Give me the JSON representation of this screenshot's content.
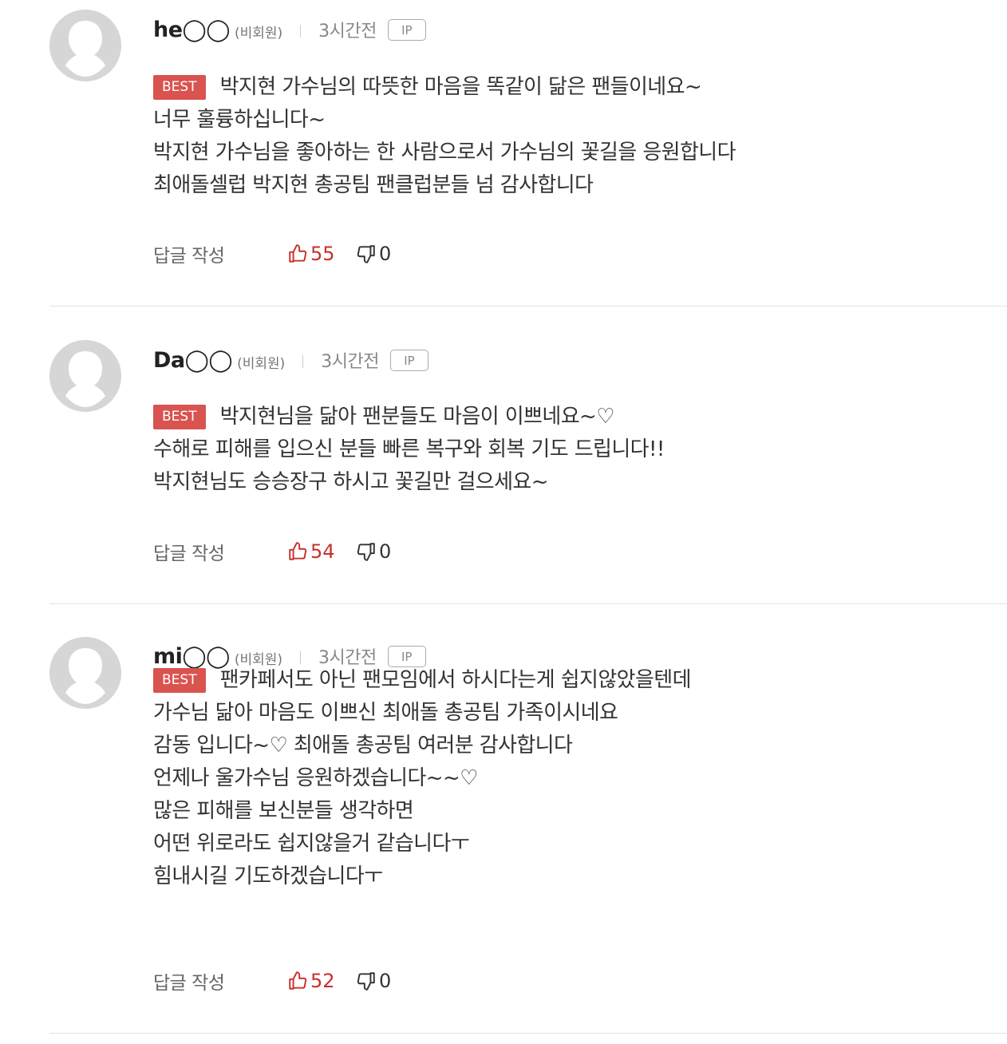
{
  "ui": {
    "member_label": "(비회원)",
    "ip_label": "IP",
    "best_label": "BEST",
    "reply_label": "답글 작성",
    "colors": {
      "best_badge": "#d9534f",
      "like": "#c9302c",
      "avatar": "#d6d6d6"
    },
    "icons": [
      "user-avatar-icon",
      "thumbs-up-icon",
      "thumbs-down-icon"
    ]
  },
  "comments": [
    {
      "nickname": "he◯◯",
      "time": "3시간전",
      "lines": [
        "박지현 가수님의 따뜻한 마음을 똑같이 닮은 팬들이네요~",
        "너무 훌륭하십니다~",
        "박지현 가수님을 좋아하는 한 사람으로서 가수님의 꽃길을 응원합니다",
        "최애돌셀럽 박지현 총공팀 팬클럽분들 넘 감사합니다"
      ],
      "likes": "55",
      "dislikes": "0"
    },
    {
      "nickname": "Da◯◯",
      "time": "3시간전",
      "lines": [
        "박지현님을 닮아 팬분들도 마음이 이쁘네요~♡",
        "수해로 피해를 입으신 분들 빠른 복구와 회복 기도 드립니다!!",
        "박지현님도 승승장구 하시고 꽃길만 걸으세요~"
      ],
      "likes": "54",
      "dislikes": "0"
    },
    {
      "nickname": "mi◯◯",
      "time": "3시간전",
      "lines": [
        "팬카페서도 아닌 팬모임에서 하시다는게 쉽지않았을텐데",
        "가수님 닮아 마음도 이쁘신 최애돌 총공팀 가족이시네요",
        "감동 입니다~♡ 최애돌 총공팀 여러분 감사합니다",
        "언제나 울가수님 응원하겠습니다~~♡",
        "많은 피해를 보신분들 생각하면",
        "어떤 위로라도 쉽지않을거 같습니다ㅜ",
        "힘내시길 기도하겠습니다ㅜ"
      ],
      "likes": "52",
      "dislikes": "0"
    }
  ]
}
